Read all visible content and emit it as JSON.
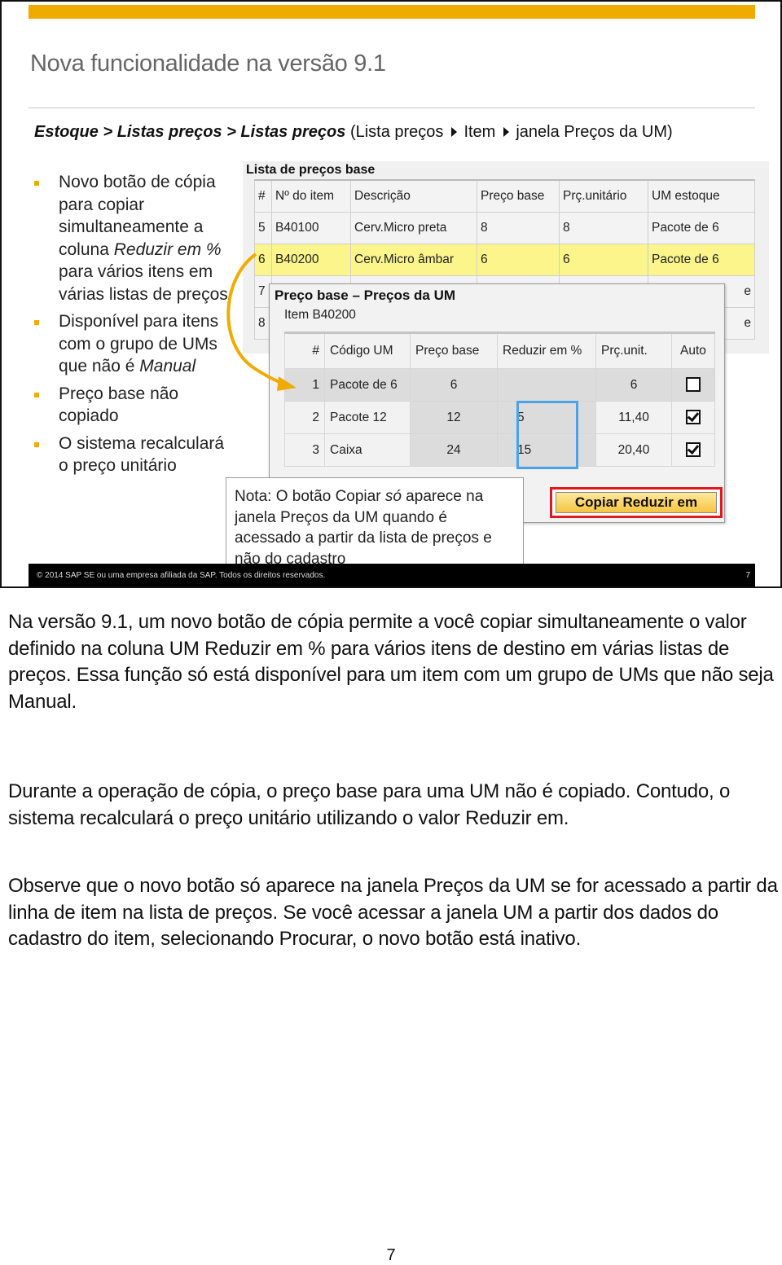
{
  "slide": {
    "title": "Nova funcionalidade na versão 9.1",
    "breadcrumb": {
      "path_bold": "Estoque > Listas preços > Listas preços",
      "open_paren": "(Lista preços",
      "step2": "Item",
      "step3": "janela Preços da UM)"
    },
    "bullets": [
      {
        "pre": "Novo botão de cópia para copiar simultaneamente a coluna ",
        "italic": "Reduzir em %",
        "post": " para vários itens em várias listas de preços"
      },
      {
        "pre": "Disponível para itens com o grupo de UMs que não é ",
        "italic": "Manual",
        "post": ""
      },
      {
        "pre": "Preço base não copiado",
        "italic": "",
        "post": ""
      },
      {
        "pre": "O sistema recalculará o preço unitário",
        "italic": "",
        "post": ""
      }
    ],
    "price_list": {
      "title": "Lista de preços base",
      "columns": [
        "#",
        "Nº do item",
        "Descrição",
        "Preço base",
        "Prç.unitário",
        "UM estoque"
      ],
      "rows": [
        {
          "num": "5",
          "item": "B40100",
          "desc": "Cerv.Micro preta",
          "base": "8",
          "unit": "8",
          "um": "Pacote de 6",
          "highlighted": false
        },
        {
          "num": "6",
          "item": "B40200",
          "desc": "Cerv.Micro âmbar",
          "base": "6",
          "unit": "6",
          "um": "Pacote de 6",
          "highlighted": true
        },
        {
          "num": "7",
          "item": "",
          "desc": "",
          "base": "",
          "unit": "",
          "um": "e",
          "highlighted": false
        },
        {
          "num": "8",
          "item": "",
          "desc": "",
          "base": "",
          "unit": "",
          "um": "e",
          "highlighted": false
        }
      ]
    },
    "um_window": {
      "title": "Preço base  – Preços da UM",
      "subtitle": "Item B40200",
      "columns": [
        "#",
        "Código UM",
        "Preço base",
        "Reduzir em %",
        "Prç.unit.",
        "Auto"
      ],
      "rows": [
        {
          "num": "1",
          "code": "Pacote de 6",
          "base": "6",
          "reduce": "",
          "unit": "6",
          "auto": false
        },
        {
          "num": "2",
          "code": "Pacote 12",
          "base": "12",
          "reduce": "5",
          "unit": "11,40",
          "auto": true
        },
        {
          "num": "3",
          "code": "Caixa",
          "base": "24",
          "reduce": "15",
          "unit": "20,40",
          "auto": true
        }
      ],
      "copy_button": "Copiar Reduzir em"
    },
    "note": {
      "pre": "Nota: O botão Copiar ",
      "italic": "só",
      "post": " aparece na janela Preços da UM quando é acessado a partir da lista de preços e não do cadastro"
    },
    "footer": {
      "copyright": "© 2014 SAP SE ou uma empresa afiliada da SAP. Todos os direitos reservados.",
      "page": "7"
    },
    "colors": {
      "accent": "#f0ab00",
      "highlight_row": "#fbf58c",
      "blue_selection": "#4aa3e6",
      "red_outline": "#e0191c"
    }
  },
  "body": {
    "paragraphs": [
      "Na versão 9.1, um novo botão de cópia permite a você copiar simultaneamente o valor definido na coluna UM Reduzir em % para vários itens de destino em várias listas de preços. Essa função só está disponível para um item com um grupo de UMs que não seja Manual.",
      "Durante a operação de cópia, o preço base para uma UM não é copiado. Contudo, o sistema recalculará o preço unitário utilizando o valor Reduzir em.",
      "Observe que o novo botão só aparece na janela Preços da UM se for acessado a partir da linha de item na lista de preços. Se você acessar a janela UM a partir dos dados do cadastro do item, selecionando Procurar, o novo botão está inativo."
    ],
    "page_number": "7"
  }
}
